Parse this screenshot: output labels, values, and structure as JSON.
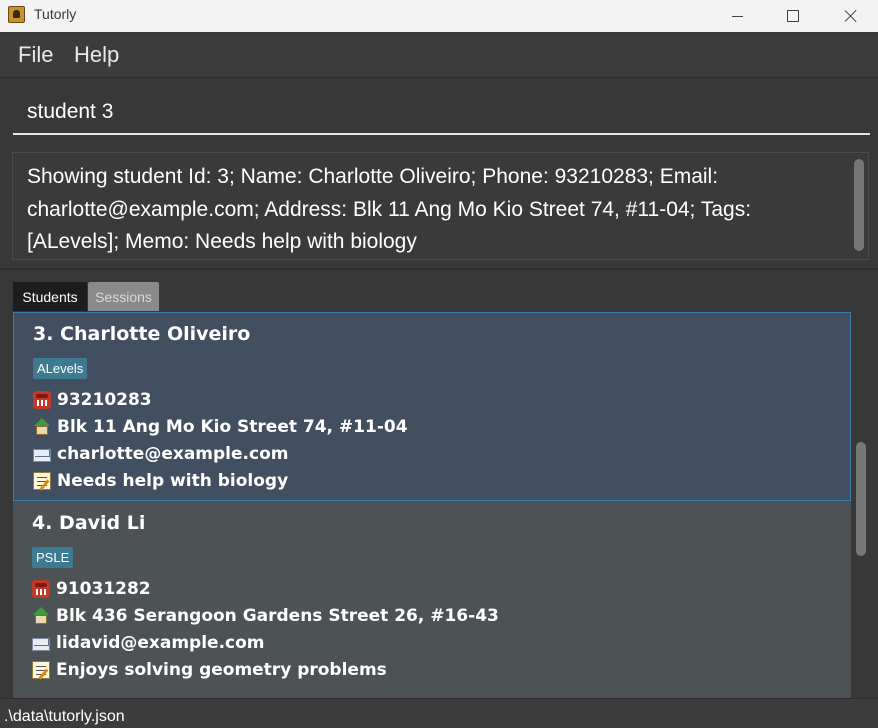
{
  "window": {
    "title": "Tutorly"
  },
  "menu": {
    "items": [
      "File",
      "Help"
    ]
  },
  "command": {
    "value": "student 3"
  },
  "result": {
    "text": "Showing student Id: 3; Name: Charlotte Oliveiro; Phone: 93210283; Email: charlotte@example.com; Address: Blk 11 Ang Mo Kio Street 74, #11-04; Tags: [ALevels]; Memo: Needs help with biology"
  },
  "tabs": [
    {
      "label": "Students",
      "selected": true
    },
    {
      "label": "Sessions",
      "selected": false
    }
  ],
  "students": [
    {
      "name": "3. Charlotte Oliveiro",
      "tag": "ALevels",
      "phone": "93210283",
      "address": "Blk 11 Ang Mo Kio Street 74, #11-04",
      "email": "charlotte@example.com",
      "memo": "Needs help with biology",
      "selected": true
    },
    {
      "name": "4. David Li",
      "tag": "PSLE",
      "phone": "91031282",
      "address": "Blk 436 Serangoon Gardens Street 26, #16-43",
      "email": "lidavid@example.com",
      "memo": "Enjoys solving geometry problems",
      "selected": false
    }
  ],
  "status": {
    "path": ".\\data\\tutorly.json"
  },
  "colors": {
    "selected_card": "#424f60",
    "card": "#4d5254",
    "tag": "#3e7b91",
    "background": "#383838"
  }
}
